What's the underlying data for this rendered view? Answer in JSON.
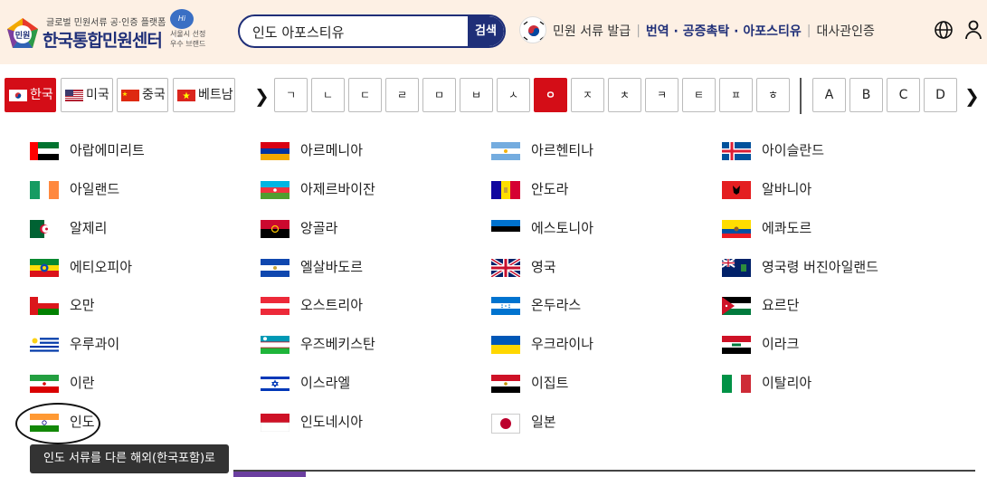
{
  "header": {
    "logo_small": "글로벌 민원서류 공·인증 플랫폼",
    "logo_title": "한국통합민원센터",
    "logo_mark": "민원",
    "hiseoul_badge": "Hi Seoul",
    "hiseoul_line1": "서울시 선정",
    "hiseoul_line2": "우수 브랜드",
    "search_value": "인도 아포스티유",
    "search_button": "검색",
    "nav": [
      "민원 서류 발급",
      "번역 · 공증촉탁 · 아포스티유",
      "대사관인증"
    ]
  },
  "country_tabs": [
    {
      "label": "한국",
      "active": true
    },
    {
      "label": "미국",
      "active": false
    },
    {
      "label": "중국",
      "active": false
    },
    {
      "label": "베트남",
      "active": false
    }
  ],
  "hangul_keys": [
    "ㄱ",
    "ㄴ",
    "ㄷ",
    "ㄹ",
    "ㅁ",
    "ㅂ",
    "ㅅ",
    "ㅇ",
    "ㅈ",
    "ㅊ",
    "ㅋ",
    "ㅌ",
    "ㅍ",
    "ㅎ"
  ],
  "active_key": "ㅇ",
  "latin_keys": [
    "A",
    "B",
    "C",
    "D"
  ],
  "countries": [
    [
      "아랍에미리트",
      "아르메니아",
      "아르헨티나",
      "아이슬란드"
    ],
    [
      "아일랜드",
      "아제르바이잔",
      "안도라",
      "알바니아"
    ],
    [
      "알제리",
      "앙골라",
      "에스토니아",
      "에콰도르"
    ],
    [
      "에티오피아",
      "엘살바도르",
      "영국",
      "영국령 버진아일랜드"
    ],
    [
      "오만",
      "오스트리아",
      "온두라스",
      "요르단"
    ],
    [
      "우루과이",
      "우즈베키스탄",
      "우크라이나",
      "이라크"
    ],
    [
      "이란",
      "이스라엘",
      "이집트",
      "이탈리아"
    ],
    [
      "인도",
      "인도네시아",
      "일본",
      ""
    ]
  ],
  "tooltip": "인도 서류를 다른 해외(한국포함)로",
  "colors": {
    "brand_navy": "#1f2f78",
    "active_red": "#d40d17",
    "header_bg": "#fdf0e4"
  },
  "icons": {
    "globe": "globe-icon",
    "user": "user-icon",
    "chevron_left": "chevron-right-icon",
    "chevron_right": "chevron-right-icon"
  }
}
